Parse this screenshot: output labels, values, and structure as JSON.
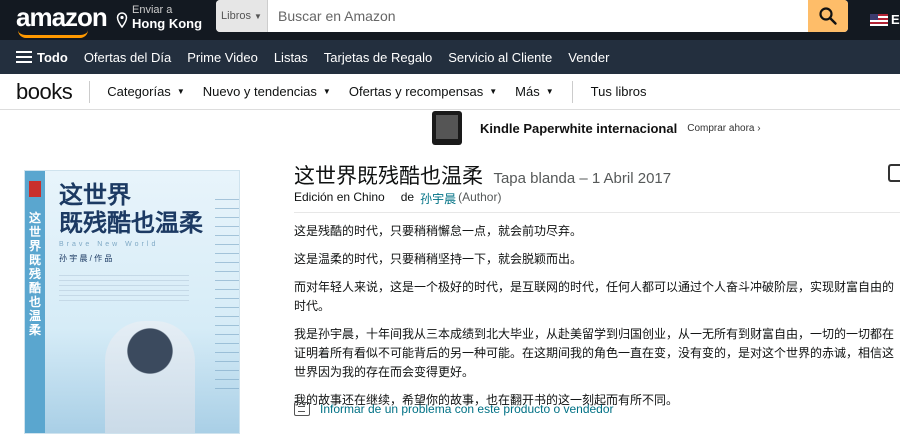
{
  "header": {
    "logo": "amazon",
    "deliver_line1": "Enviar a",
    "deliver_line2": "Hong Kong",
    "search_category": "Libros",
    "search_placeholder": "Buscar en Amazon",
    "language": "ES"
  },
  "nav": {
    "all_label": "Todo",
    "links": [
      "Ofertas del Día",
      "Prime Video",
      "Listas",
      "Tarjetas de Regalo",
      "Servicio al Cliente",
      "Vender"
    ]
  },
  "subnav": {
    "store_logo": "books",
    "items": [
      "Categorías",
      "Nuevo y tendencias",
      "Ofertas y recompensas",
      "Más"
    ],
    "tus_libros": "Tus libros"
  },
  "banner": {
    "title": "Kindle Paperwhite internacional",
    "cta": "Comprar ahora ›"
  },
  "cover": {
    "title_line1": "这世界",
    "title_line2": "既残酷也温柔",
    "subtitle_en": "Brave New World",
    "author_line": "孙 宇 晨   /  作 品",
    "vertical_title": "这世界既残酷也温柔"
  },
  "product": {
    "title": "这世界既残酷也温柔",
    "format_date": "Tapa blanda – 1 Abril 2017",
    "edition": "Edición en Chino",
    "by": "de",
    "author": "孙宇晨",
    "author_role": "(Author)"
  },
  "description": [
    "这是残酷的时代，只要稍稍懈怠一点，就会前功尽弃。",
    "这是温柔的时代，只要稍稍坚持一下，就会脱颖而出。",
    "而对年轻人来说，这是一个极好的时代，是互联网的时代，任何人都可以通过个人奋斗冲破阶层，实现财富自由的时代。",
    "我是孙宇晨，十年间我从三本成绩到北大毕业，从赴美留学到归国创业，从一无所有到财富自由，一切的一切都在证明着所有看似不可能背后的另一种可能。在这期间我的角色一直在变，没有变的，是对这个世界的赤诚，相信这世界因为我的存在而会变得更好。",
    "我的故事还在继续，希望你的故事，也在翻开书的这一刻起而有所不同。"
  ],
  "report_link": "Informar de un problema con este producto o vendedor"
}
